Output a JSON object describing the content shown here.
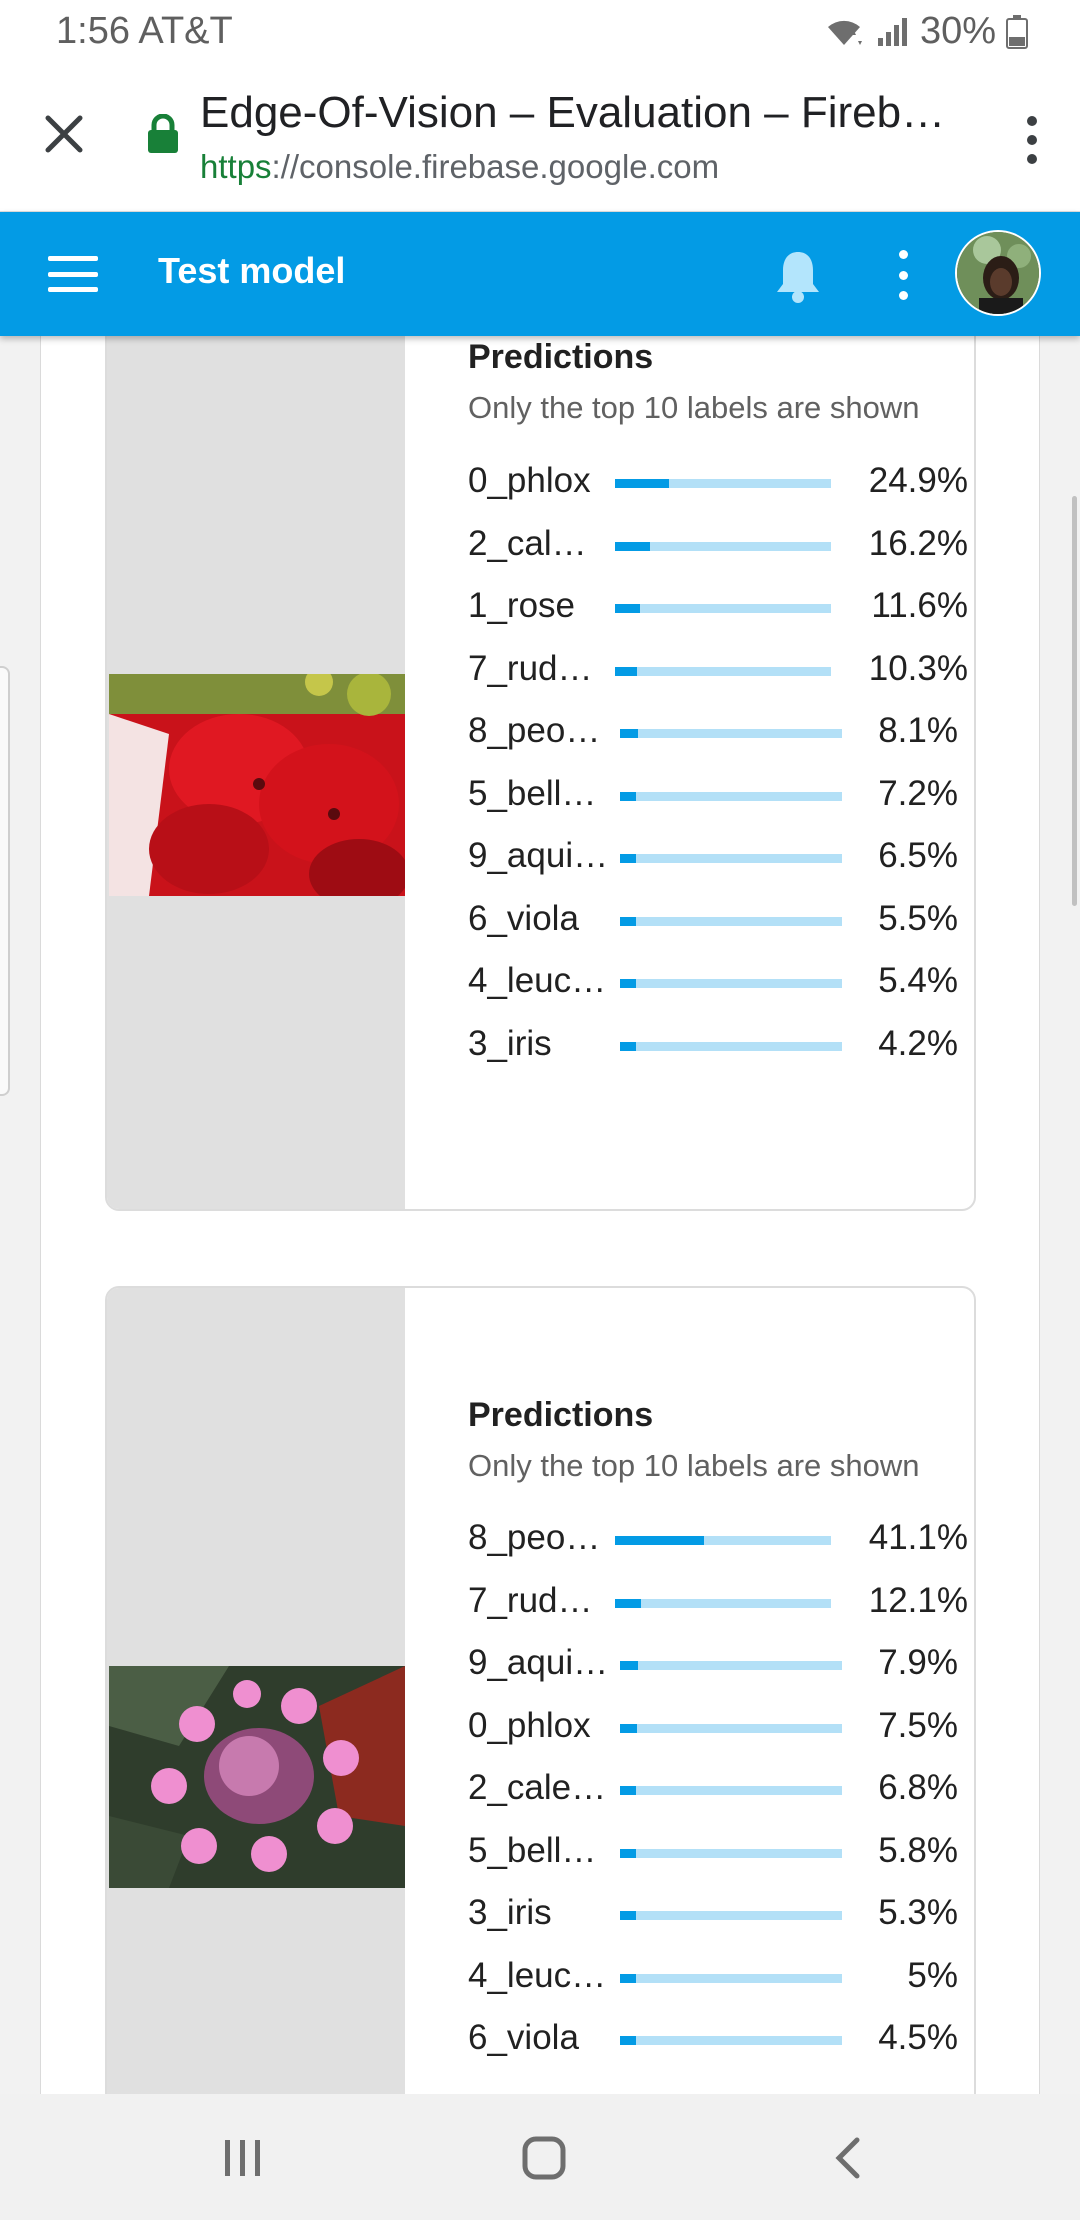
{
  "status": {
    "time": "1:56 AT&T",
    "battery": "30%"
  },
  "browser": {
    "title": "Edge-Of-Vision – Evaluation – Firebase",
    "url_scheme": "https",
    "url_rest": "://console.firebase.google.com"
  },
  "app_bar": {
    "title": "Test model"
  },
  "cards": [
    {
      "image": "red-petunia-photo",
      "title": "Predictions",
      "subtitle": "Only the top 10 labels are shown",
      "rows": [
        {
          "label": "0_phlox",
          "value": "24.9%",
          "fraction": 0.249
        },
        {
          "label": "2_cal…",
          "value": "16.2%",
          "fraction": 0.162
        },
        {
          "label": "1_rose",
          "value": "11.6%",
          "fraction": 0.116
        },
        {
          "label": "7_rud…",
          "value": "10.3%",
          "fraction": 0.103
        },
        {
          "label": "8_peo…",
          "value": "8.1%",
          "fraction": 0.081
        },
        {
          "label": "5_bell…",
          "value": "7.2%",
          "fraction": 0.072
        },
        {
          "label": "9_aqui…",
          "value": "6.5%",
          "fraction": 0.065
        },
        {
          "label": "6_viola",
          "value": "5.5%",
          "fraction": 0.055
        },
        {
          "label": "4_leuc…",
          "value": "5.4%",
          "fraction": 0.054
        },
        {
          "label": "3_iris",
          "value": "4.2%",
          "fraction": 0.042
        }
      ]
    },
    {
      "image": "pink-hydrangea-photo",
      "title": "Predictions",
      "subtitle": "Only the top 10 labels are shown",
      "rows": [
        {
          "label": "8_peo…",
          "value": "41.1%",
          "fraction": 0.411
        },
        {
          "label": "7_rud…",
          "value": "12.1%",
          "fraction": 0.121
        },
        {
          "label": "9_aqui…",
          "value": "7.9%",
          "fraction": 0.079
        },
        {
          "label": "0_phlox",
          "value": "7.5%",
          "fraction": 0.075
        },
        {
          "label": "2_cale…",
          "value": "6.8%",
          "fraction": 0.068
        },
        {
          "label": "5_bell…",
          "value": "5.8%",
          "fraction": 0.058
        },
        {
          "label": "3_iris",
          "value": "5.3%",
          "fraction": 0.053
        },
        {
          "label": "4_leuc…",
          "value": "5%",
          "fraction": 0.05
        },
        {
          "label": "6_viola",
          "value": "4.5%",
          "fraction": 0.045
        }
      ]
    }
  ],
  "colors": {
    "accent": "#039be5",
    "bar_track": "#b3e0f7",
    "secure": "#188038"
  }
}
